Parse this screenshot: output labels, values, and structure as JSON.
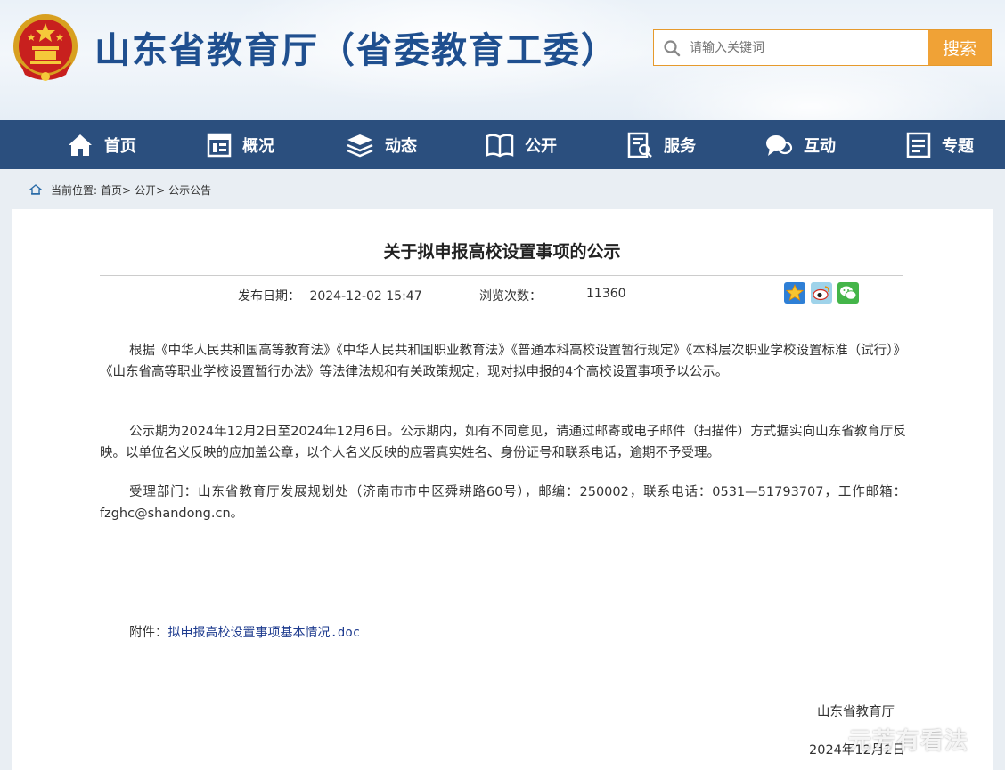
{
  "header": {
    "site_title": "山东省教育厅（省委教育工委）",
    "search_placeholder": "请输入关键词",
    "search_button": "搜索"
  },
  "nav": {
    "items": [
      {
        "label": "首页",
        "icon": "home-icon"
      },
      {
        "label": "概况",
        "icon": "overview-icon"
      },
      {
        "label": "动态",
        "icon": "news-icon"
      },
      {
        "label": "公开",
        "icon": "book-icon"
      },
      {
        "label": "服务",
        "icon": "service-icon"
      },
      {
        "label": "互动",
        "icon": "chat-icon"
      },
      {
        "label": "专题",
        "icon": "topic-icon"
      }
    ]
  },
  "breadcrumb": {
    "prefix": "当前位置:",
    "items": [
      "首页>",
      "公开>",
      "公示公告"
    ]
  },
  "article": {
    "title": "关于拟申报高校设置事项的公示",
    "publish_label": "发布日期：",
    "publish_date": "2024-12-02 15:47",
    "views_label": "浏览次数：",
    "views": "11360",
    "paragraphs": [
      "根据《中华人民共和国高等教育法》《中华人民共和国职业教育法》《普通本科高校设置暂行规定》《本科层次职业学校设置标准（试行）》《山东省高等职业学校设置暂行办法》等法律法规和有关政策规定，现对拟申报的4个高校设置事项予以公示。",
      "公示期为2024年12月2日至2024年12月6日。公示期内，如有不同意见，请通过邮寄或电子邮件（扫描件）方式据实向山东省教育厅反映。以单位名义反映的应加盖公章，以个人名义反映的应署真实姓名、身份证号和联系电话，逾期不予受理。",
      "受理部门：山东省教育厅发展规划处（济南市市中区舜耕路60号），邮编：250002，联系电话：0531—51793707，工作邮箱：fzghc@shandong.cn。"
    ],
    "attachment_label": "附件：",
    "attachment_link": "拟申报高校设置事项基本情况.doc",
    "signature": "山东省教育厅",
    "sign_date": "2024年12月2日"
  },
  "watermark": "元芳有看法",
  "colors": {
    "title_blue": "#1f4f8f",
    "nav_bg": "#2b4f7e",
    "search_orange": "#f0a236",
    "link_blue": "#1f3c8f"
  }
}
